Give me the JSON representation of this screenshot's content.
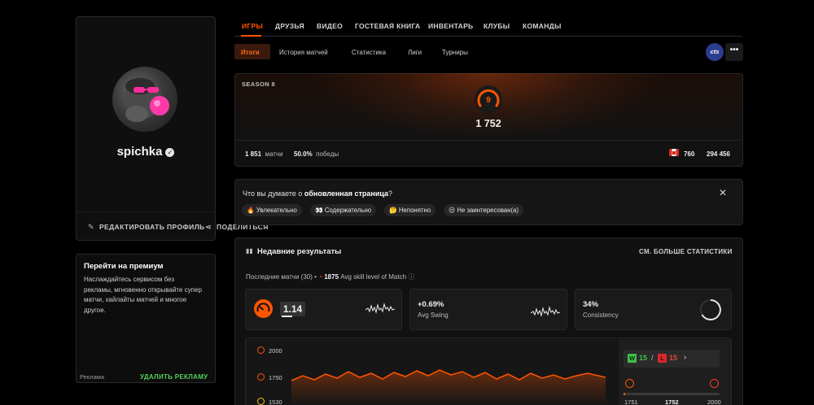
{
  "profile": {
    "username": "spichka",
    "edit_label": "РЕДАКТИРОВАТЬ ПРОФИЛЬ",
    "share_label": "ПОДЕЛИТЬСЯ"
  },
  "premium": {
    "title": "Перейти на премиум",
    "text": "Наслаждайтесь сервисом без рекламы, мгновенно открывайте супер матчи, хайлайты матчей и многое другое.",
    "ad_label": "Реклама",
    "remove_ad_label": "УДАЛИТЬ РЕКЛАМУ"
  },
  "nav": {
    "tabs": [
      "ИГРЫ",
      "ДРУЗЬЯ",
      "ВИДЕО",
      "ГОСТЕВАЯ КНИГА",
      "ИНВЕНТАРЬ",
      "КЛУБЫ",
      "КОМАНДЫ"
    ],
    "active_tab": "ИГРЫ"
  },
  "subnav": {
    "tabs": [
      "Итоги",
      "История матчей",
      "Статистика",
      "Лиги",
      "Турниры"
    ],
    "active_tab": "Итоги",
    "game_badge": "cts",
    "more": "•••"
  },
  "season": {
    "label": "SEASON 8",
    "level": "9",
    "elo": "1 752",
    "matches_value": "1 851",
    "matches_label": "матчи",
    "winrate_value": "50.0%",
    "winrate_label": "победы",
    "country_rank": "760",
    "global_rank": "294 456"
  },
  "feedback": {
    "question_prefix": "Что вы думаете о ",
    "question_bold": "обновленная страница",
    "question_suffix": "?",
    "options": [
      {
        "icon": "🔥",
        "label": "Увлекательно"
      },
      {
        "icon": "👀",
        "label": "Содержательно"
      },
      {
        "icon": "🤔",
        "label": "Непонятно"
      },
      {
        "icon": "😒",
        "label": "Не заинтересован(а)"
      }
    ]
  },
  "results": {
    "title": "Недавние результаты",
    "more_stats": "СМ. БОЛЬШЕ СТАТИСТИКИ",
    "recent_prefix": "Последние матчи (30) •",
    "avg_skill_value": "1875",
    "avg_skill_label": "Avg skill level of Match",
    "metrics": [
      {
        "value": "1.14",
        "label": ""
      },
      {
        "value": "+0.69%",
        "label": "Avg Swing"
      },
      {
        "value": "34%",
        "label": "Consistency"
      }
    ],
    "chart_ticks": [
      "2000",
      "1750",
      "1530"
    ],
    "wins_letter": "W",
    "wins": "15",
    "losses_letter": "L",
    "losses": "15",
    "separator": "/",
    "range_min": "1751",
    "range_current": "1752",
    "range_max": "2000"
  },
  "colors": {
    "accent": "#ff5500",
    "win": "#3fbf4a",
    "loss": "#d9262c",
    "premium_cta": "#52d15d"
  }
}
